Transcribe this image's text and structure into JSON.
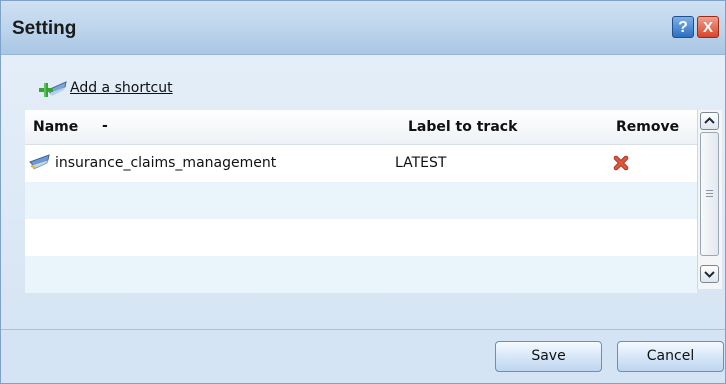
{
  "dialog": {
    "title": "Setting",
    "help_label": "?",
    "close_label": "X"
  },
  "shortcut": {
    "label": "Add a shortcut",
    "icon": "add-shortcut-icon"
  },
  "table": {
    "columns": {
      "name": "Name",
      "sort_indicator": "-",
      "label": "Label to track",
      "remove": "Remove"
    },
    "rows": [
      {
        "name": "insurance_claims_management",
        "label": "LATEST",
        "icon": "stream-icon",
        "remove_icon": "red-x-icon"
      }
    ]
  },
  "buttons": {
    "save": "Save",
    "cancel": "Cancel"
  },
  "colors": {
    "title_bar": "#bcd4ec",
    "dialog_bg": "#d2e3f3",
    "alt_row": "#e9f4fb",
    "remove_x": "#d4452a"
  }
}
